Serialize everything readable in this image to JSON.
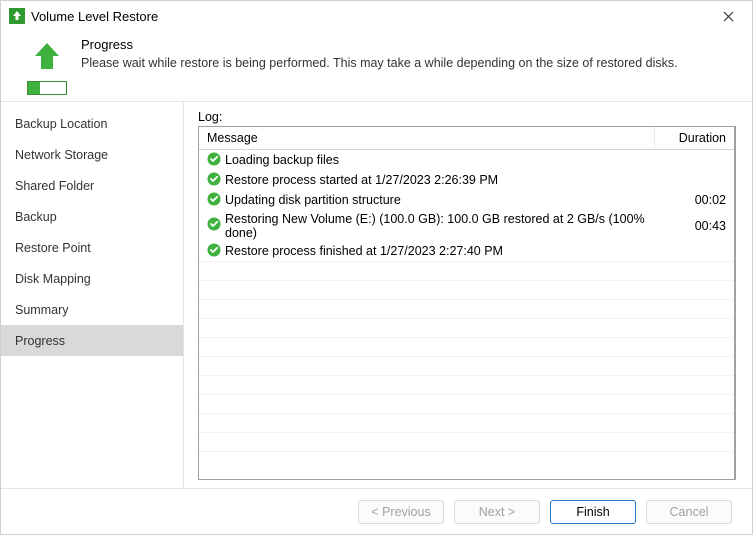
{
  "window": {
    "title": "Volume Level Restore"
  },
  "header": {
    "title": "Progress",
    "description": "Please wait while restore is being performed. This may take a while depending on the size of restored disks."
  },
  "sidebar": {
    "items": [
      {
        "label": "Backup Location",
        "active": false
      },
      {
        "label": "Network Storage",
        "active": false
      },
      {
        "label": "Shared Folder",
        "active": false
      },
      {
        "label": "Backup",
        "active": false
      },
      {
        "label": "Restore Point",
        "active": false
      },
      {
        "label": "Disk Mapping",
        "active": false
      },
      {
        "label": "Summary",
        "active": false
      },
      {
        "label": "Progress",
        "active": true
      }
    ]
  },
  "log": {
    "label": "Log:",
    "columns": {
      "message": "Message",
      "duration": "Duration"
    },
    "rows": [
      {
        "status": "ok",
        "message": "Loading backup files",
        "duration": ""
      },
      {
        "status": "ok",
        "message": "Restore process started at 1/27/2023 2:26:39 PM",
        "duration": ""
      },
      {
        "status": "ok",
        "message": "Updating disk partition structure",
        "duration": "00:02"
      },
      {
        "status": "ok",
        "message": "Restoring New Volume (E:) (100.0 GB): 100.0 GB restored at 2 GB/s (100% done)",
        "duration": "00:43"
      },
      {
        "status": "ok",
        "message": "Restore process finished at 1/27/2023 2:27:40 PM",
        "duration": ""
      }
    ]
  },
  "footer": {
    "previous": "< Previous",
    "next": "Next >",
    "finish": "Finish",
    "cancel": "Cancel"
  },
  "colors": {
    "accent_green": "#3fb13f",
    "primary_blue": "#2577c4"
  }
}
